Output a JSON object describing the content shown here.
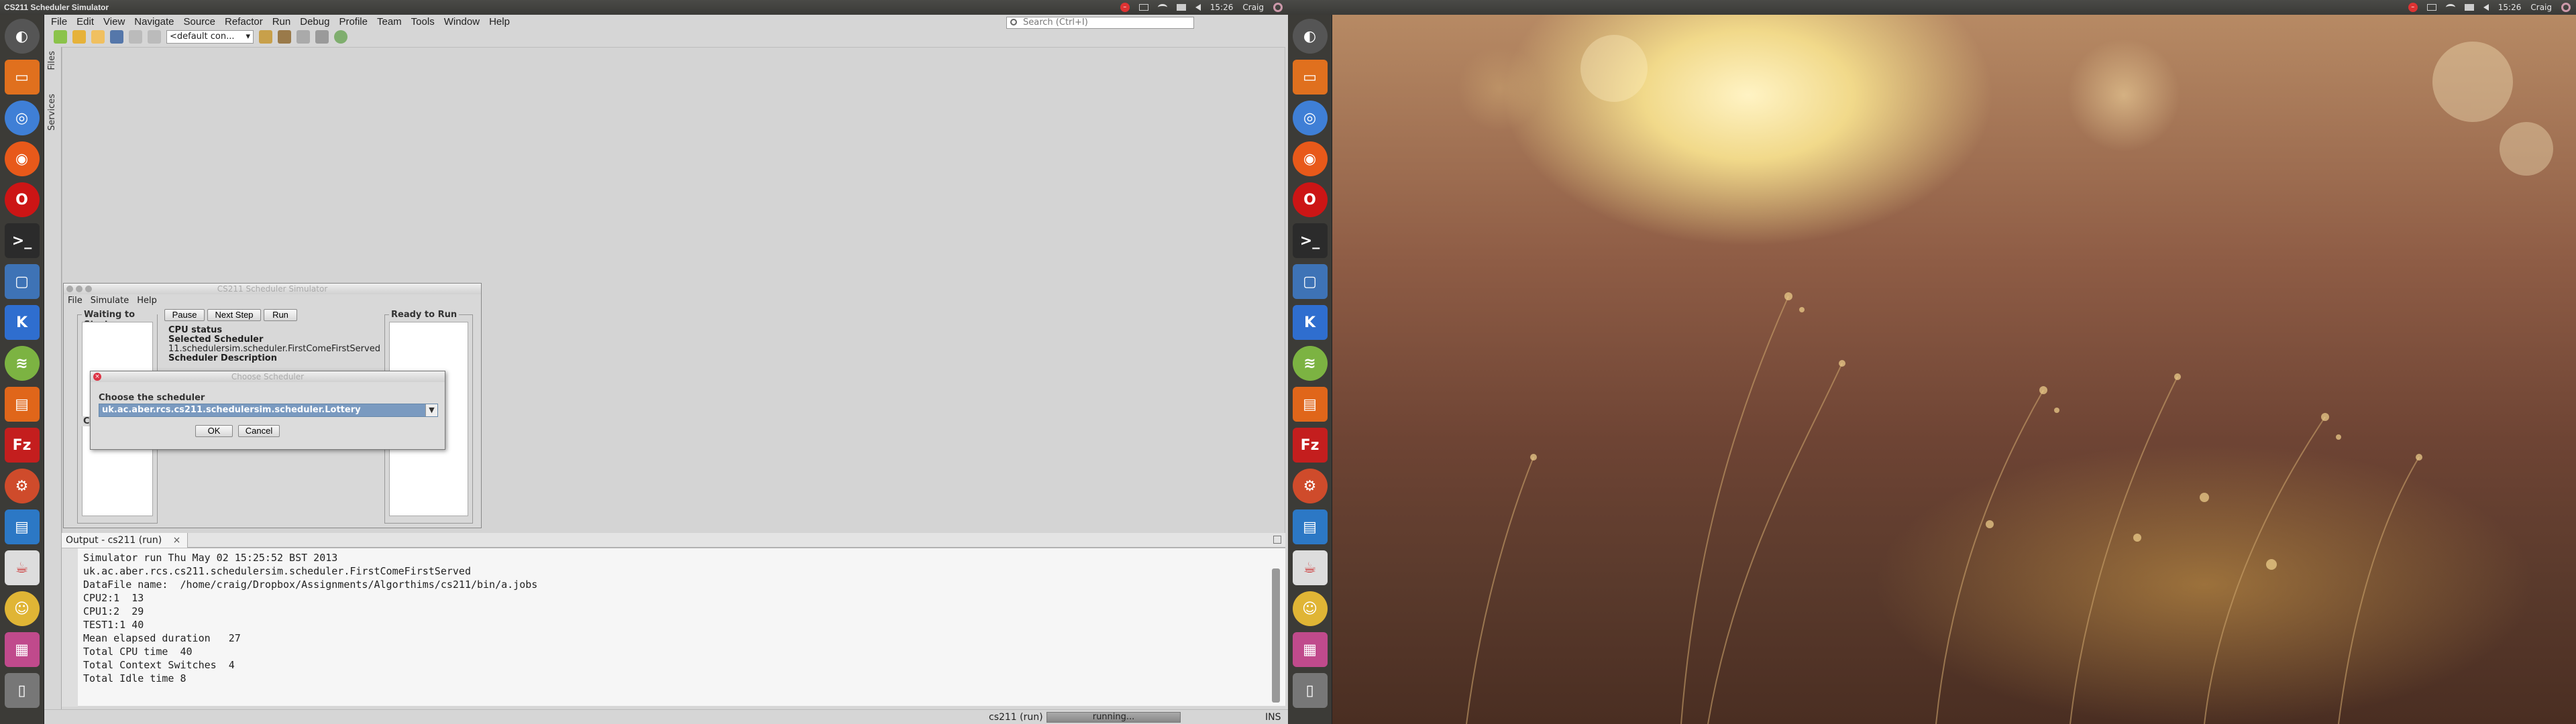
{
  "screen1": {
    "window_title": "CS211 Scheduler Simulator",
    "clock": "15:26",
    "user": "Craig",
    "netbeans": {
      "menu": [
        "File",
        "Edit",
        "View",
        "Navigate",
        "Source",
        "Refactor",
        "Run",
        "Debug",
        "Profile",
        "Team",
        "Tools",
        "Window",
        "Help"
      ],
      "search_placeholder": "Search (Ctrl+I)",
      "config_select": "<default con...",
      "side_tabs": [
        "Files",
        "Services"
      ],
      "output": {
        "tab_label": "Output - cs211 (run)",
        "lines": [
          "Simulator run Thu May 02 15:25:52 BST 2013",
          "uk.ac.aber.rcs.cs211.schedulersim.scheduler.FirstComeFirstServed",
          "DataFile name:  /home/craig/Dropbox/Assignments/Algorthims/cs211/bin/a.jobs",
          "CPU2:1  13",
          "CPU1:2  29",
          "TEST1:1 40",
          "Mean elapsed duration   27",
          "Total CPU time  40",
          "Total Context Switches  4",
          "Total Idle time 8"
        ]
      },
      "status": {
        "project": "cs211 (run)",
        "progress": "running...",
        "mode": "INS"
      }
    },
    "simulator": {
      "title": "CS211 Scheduler Simulator",
      "menu": [
        "File",
        "Simulate",
        "Help"
      ],
      "waiting_label": "Waiting to Start",
      "ready_label": "Ready to Run",
      "buttons": {
        "pause": "Pause",
        "next_step": "Next Step",
        "run": "Run"
      },
      "cpu_status": "CPU status",
      "selected_scheduler": "Selected Scheduler",
      "selected_value": "11.schedulersim.scheduler.FirstComeFirstServed",
      "scheduler_description": "Scheduler Description",
      "partial_left": "Co",
      "partial_right": "o"
    },
    "dialog": {
      "title": "Choose Scheduler",
      "prompt": "Choose the scheduler",
      "selected": "uk.ac.aber.rcs.cs211.schedulersim.scheduler.Lottery",
      "ok": "OK",
      "cancel": "Cancel"
    },
    "launcher_icons": [
      "dash-icon",
      "files-icon",
      "chromium-icon",
      "firefox-icon",
      "opera-icon",
      "terminal-icon",
      "virtualbox-icon",
      "kde-icon",
      "spotify-icon",
      "ubuntu-software-icon",
      "filezilla-icon",
      "settings-icon",
      "document-icon",
      "java-icon",
      "gimp-icon",
      "workspace-icon",
      "trash-icon"
    ]
  },
  "screen2": {
    "clock": "15:26",
    "user": "Craig",
    "wallpaper": "golden-grass-bokeh"
  },
  "colors": {
    "panel": "#3a3a37",
    "launcher": "#3c3b37",
    "ide_bg": "#d6d6d6",
    "selection": "#7a9ac0"
  }
}
